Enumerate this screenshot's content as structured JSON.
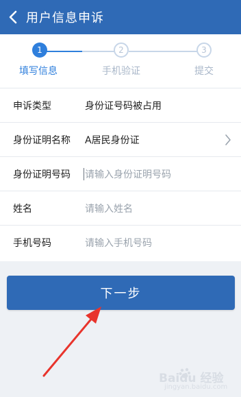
{
  "header": {
    "title": "用户信息申诉"
  },
  "steps": [
    {
      "number": "1",
      "label": "填写信息",
      "state": "active"
    },
    {
      "number": "2",
      "label": "手机验证",
      "state": "inactive"
    },
    {
      "number": "3",
      "label": "提交",
      "state": "inactive"
    }
  ],
  "form": {
    "rows": [
      {
        "label": "申诉类型",
        "value": "身份证号码被占用"
      },
      {
        "label": "身份证明名称",
        "value": "A居民身份证"
      },
      {
        "label": "身份证明号码",
        "placeholder": "请输入身份证明号码"
      },
      {
        "label": "姓名",
        "placeholder": "请输入姓名"
      },
      {
        "label": "手机号码",
        "placeholder": "请输入手机号码"
      }
    ]
  },
  "next_button": {
    "label": "下一步"
  },
  "watermark": {
    "text": "Baidu 经验",
    "sub": "jingyan.baidu.com"
  },
  "colors": {
    "primary": "#2f6ab6",
    "active_step": "#2f7fdc",
    "arrow": "#e8342c"
  }
}
